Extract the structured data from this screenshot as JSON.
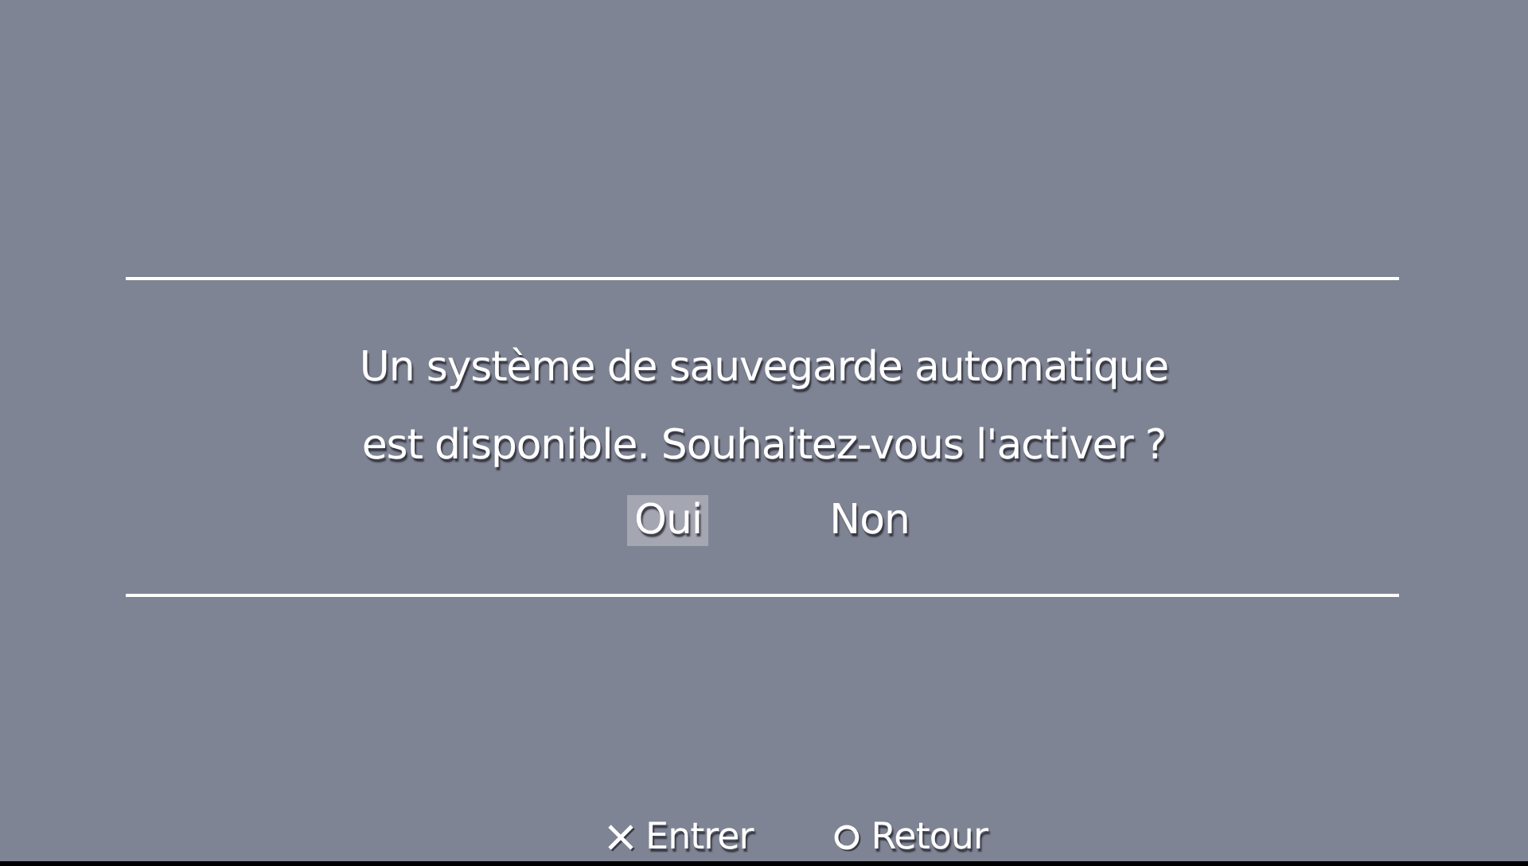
{
  "dialog": {
    "message_lines": [
      "Un système de sauvegarde automatique",
      "est disponible. Souhaitez-vous l'activer ?"
    ],
    "options": [
      {
        "label": "Oui",
        "selected": true
      },
      {
        "label": "Non",
        "selected": false
      }
    ]
  },
  "hints": [
    {
      "kind": "cross",
      "label": "Entrer"
    },
    {
      "kind": "circle",
      "label": "Retour"
    }
  ]
}
